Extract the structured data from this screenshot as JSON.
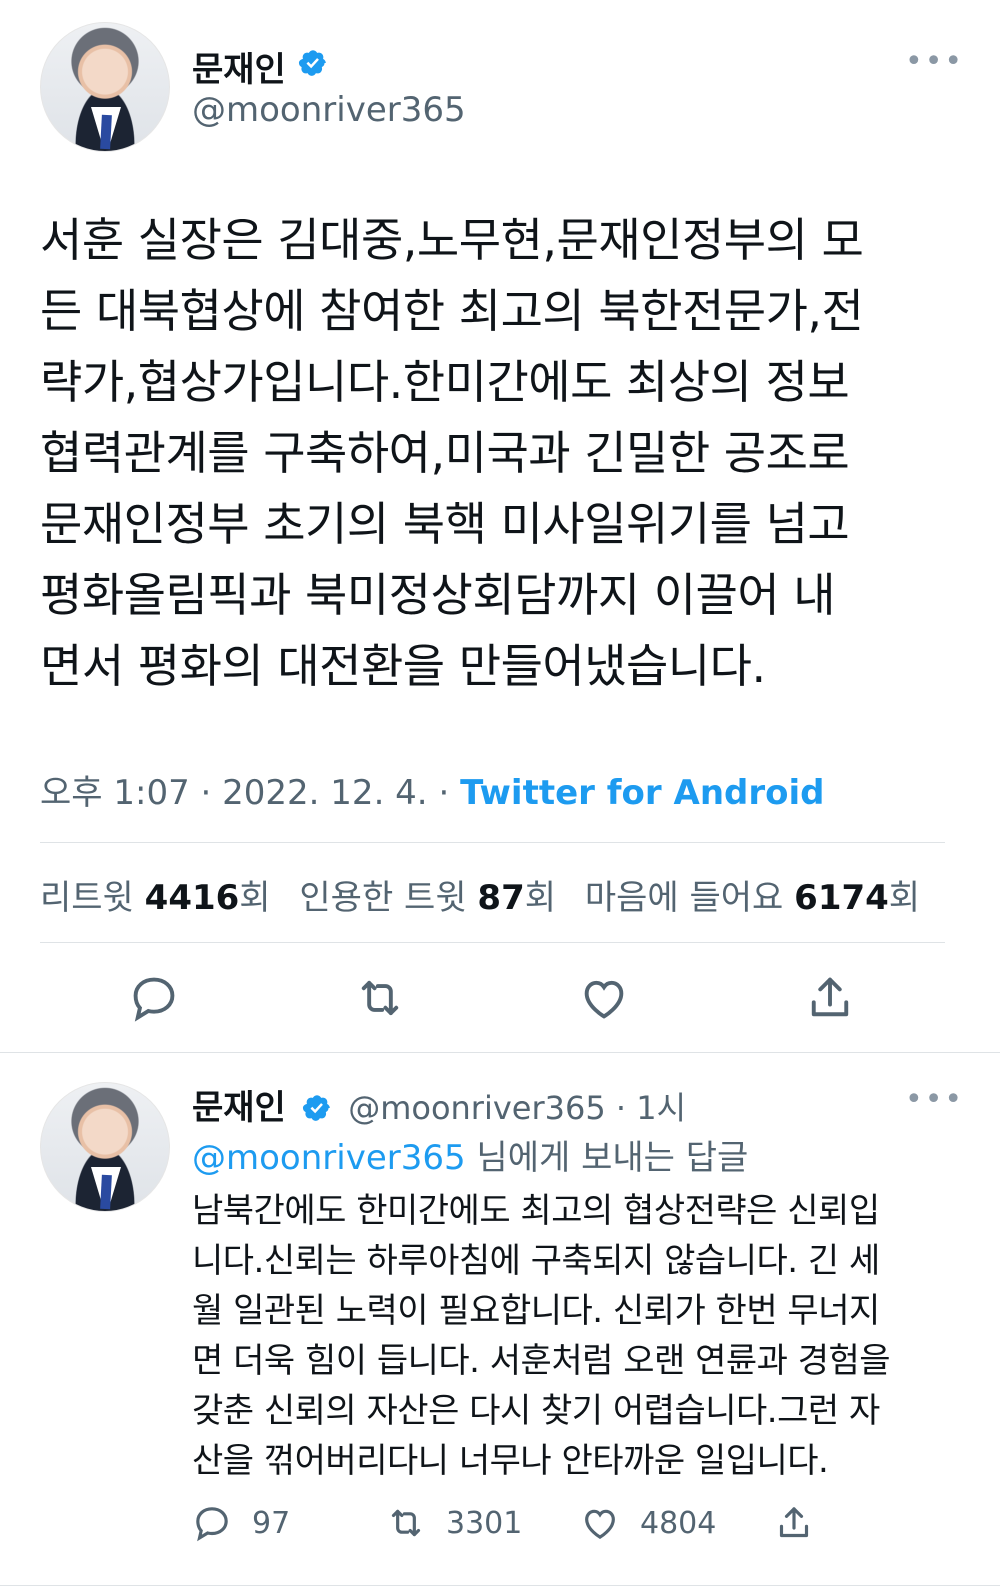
{
  "tweet": {
    "author_name": "문재인",
    "author_handle": "@moonriver365",
    "text": "서훈 실장은 김대중,노무현,문재인정부의 모\n든 대북협상에 참여한 최고의 북한전문가,전\n략가,협상가입니다.한미간에도 최상의 정보\n협력관계를 구축하여,미국과 긴밀한 공조로\n문재인정부 초기의 북핵 미사일위기를 넘고\n평화올림픽과 북미정상회담까지 이끌어 내\n면서 평화의 대전환을 만들어냈습니다.",
    "time": "오후 1:07",
    "date": "2022. 12. 4.",
    "source": "Twitter for Android",
    "stats": {
      "retweets_label": "리트윗",
      "retweets": "4416",
      "retweets_unit": "회",
      "quotes_label": "인용한 트윗",
      "quotes": "87",
      "quotes_unit": "회",
      "likes_label": "마음에 들어요",
      "likes": "6174",
      "likes_unit": "회"
    },
    "icons": [
      "reply-icon",
      "retweet-icon",
      "like-icon",
      "share-icon",
      "verified-icon",
      "more-icon"
    ]
  },
  "reply": {
    "author_name": "문재인",
    "author_handle": "@moonriver365",
    "time_ago": "· 1시",
    "replying_mention": "@moonriver365",
    "replying_suffix": " 님에게 보내는 답글",
    "text": "남북간에도 한미간에도 최고의 협상전략은 신뢰입\n니다.신뢰는 하루아침에 구축되지 않습니다. 긴 세\n월 일관된 노력이 필요합니다. 신뢰가 한번 무너지\n면 더욱 힘이 듭니다. 서훈처럼 오랜 연륜과 경험을\n갖춘 신뢰의 자산은 다시 찾기 어렵습니다.그런 자\n산을 꺾어버리다니 너무나 안타까운 일입니다.",
    "counts": {
      "replies": "97",
      "retweets": "3301",
      "likes": "4804"
    }
  },
  "colors": {
    "accent": "#1d9bf0",
    "muted": "#536471",
    "text": "#0f1419"
  }
}
